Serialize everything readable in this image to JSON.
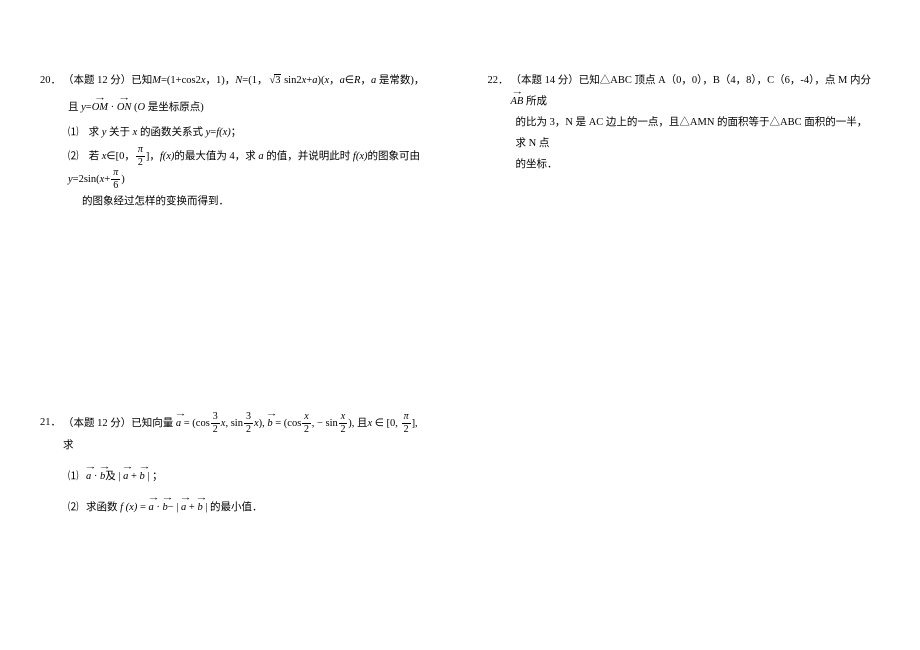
{
  "problems": {
    "p20": {
      "number": "20．",
      "head_a": "（本题 12 分）已知",
      "head_b": "=(1+cos2",
      "head_c": "，1)，",
      "head_d": "=(1，",
      "head_e": " sin2",
      "head_f": ")(",
      "head_g": "，",
      "head_h": " 是常数)，",
      "line2_a": "且 ",
      "line2_b": "=",
      "om": "OM",
      "on": "ON",
      "dot": " · ",
      "line2_c": "  (",
      "line2_d": " 是坐标原点)",
      "sub1_num": "⑴",
      "sub1_a": "求 ",
      "sub1_b": " 关于 ",
      "sub1_c": " 的函数关系式 ",
      "sub1_d": "=",
      "sub1_e": "；",
      "sub2_num": "⑵",
      "sub2_a": "若 ",
      "sub2_b": "∈[0，",
      "sub2_c": "]，",
      "sub2_d": "的最大值为 4，求 ",
      "sub2_e": " 的值，并说明此时 ",
      "sub2_f": "的图象可由 ",
      "sub2_g": "=2sin(",
      "sub2_h": "+",
      "sub2_i": ")",
      "sub2_j": "的图象经过怎样的变换而得到．",
      "pi": "π",
      "two": "2",
      "six": "6",
      "three": "3",
      "M": "M",
      "N": "N",
      "x": "x",
      "a": "a",
      "y": "y",
      "R": "R",
      "O": "O",
      "f": "f",
      "fx": "f(x)"
    },
    "p21": {
      "number": "21．",
      "head_a": "（本题 12 分）已知向量 ",
      "vec_a": "a",
      "vec_b": "b",
      "eq1_a": " = (cos",
      "eq1_b": ", sin",
      "eq1_c": "), ",
      "eq1_d": " = (cos",
      "eq1_e": ", − sin",
      "eq1_f": "), 且",
      "eq1_g": " ∈ [0, ",
      "eq1_h": "], 求",
      "three": "3",
      "two": "2",
      "x": "x",
      "pi": "π",
      "sub1_num": "⑴",
      "sub1_a": "及 | ",
      "sub1_b": " | ；",
      "plus": " + ",
      "dot": " · ",
      "sub2_num": "⑵",
      "sub2_a": "求函数 ",
      "sub2_b": " = ",
      "sub2_c": "− | ",
      "sub2_d": " | 的最小值．",
      "fx": "f (x)"
    },
    "p22": {
      "number": "22．",
      "head_a": "（本题 14 分）已知△ABC 顶点 A（0，0），B（4，8），C（6，-4），点 M 内分 ",
      "ab": "AB",
      "head_b": " 所成",
      "line2": "的比为 3，N 是 AC 边上的一点，且△AMN 的面积等于△ABC 面积的一半，求 N 点",
      "line3": "的坐标．"
    }
  }
}
